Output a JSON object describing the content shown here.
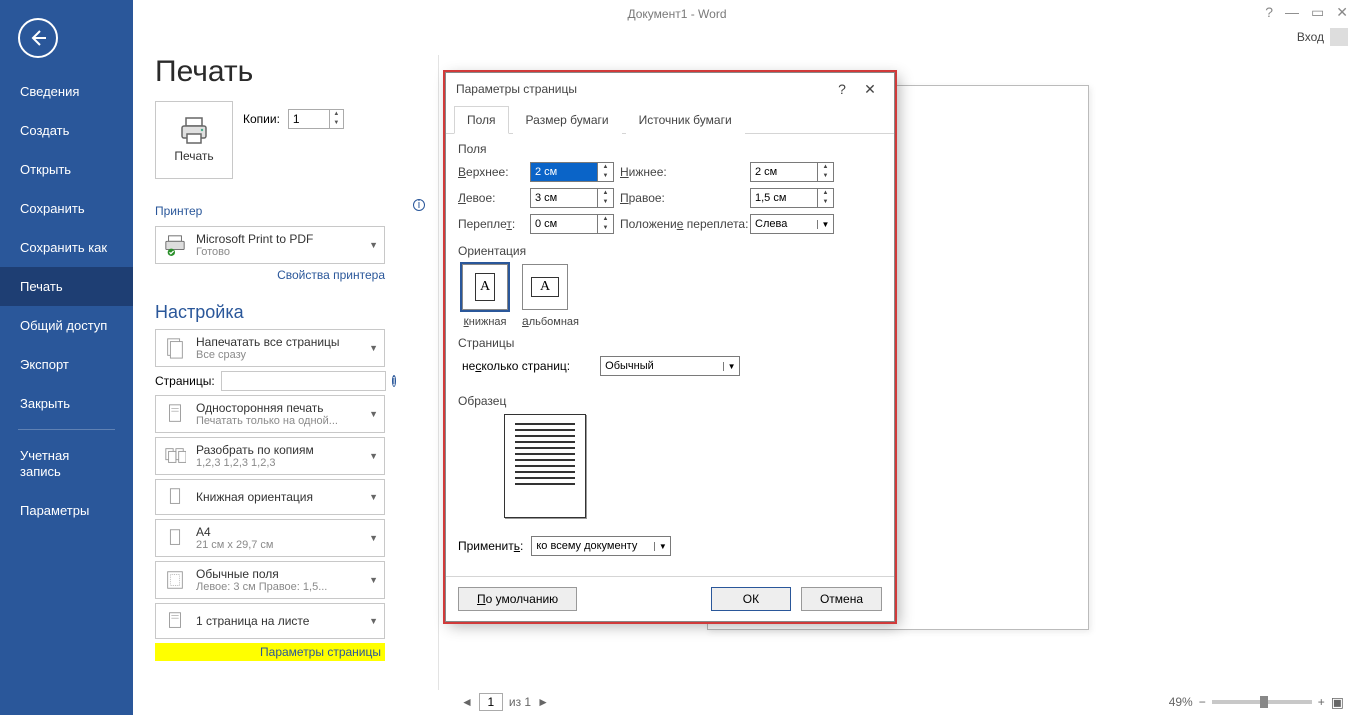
{
  "titlebar": {
    "title": "Документ1 - Word",
    "signin": "Вход"
  },
  "sidebar": {
    "items": [
      "Сведения",
      "Создать",
      "Открыть",
      "Сохранить",
      "Сохранить как",
      "Печать",
      "Общий доступ",
      "Экспорт",
      "Закрыть"
    ],
    "bottom": [
      "Учетная запись",
      "Параметры"
    ],
    "selected": 5
  },
  "print": {
    "title": "Печать",
    "button": "Печать",
    "copies_label": "Копии:",
    "copies_value": "1",
    "printer_head": "Принтер",
    "printer_name": "Microsoft Print to PDF",
    "printer_status": "Готово",
    "printer_props": "Свойства принтера",
    "settings_head": "Настройка",
    "settings": [
      {
        "t1": "Напечатать все страницы",
        "t2": "Все сразу"
      },
      {
        "t1": "Односторонняя печать",
        "t2": "Печатать только на одной..."
      },
      {
        "t1": "Разобрать по копиям",
        "t2": "1,2,3   1,2,3   1,2,3"
      },
      {
        "t1": "Книжная ориентация",
        "t2": ""
      },
      {
        "t1": "A4",
        "t2": "21 см x 29,7 см"
      },
      {
        "t1": "Обычные поля",
        "t2": "Левое:  3 см   Правое:  1,5..."
      },
      {
        "t1": "1 страница на листе",
        "t2": ""
      }
    ],
    "pages_label": "Страницы:",
    "page_params": "Параметры страницы"
  },
  "footer": {
    "page_value": "1",
    "of_label": "из 1",
    "zoom": "49%"
  },
  "dialog": {
    "title": "Параметры страницы",
    "tabs": [
      "Поля",
      "Размер бумаги",
      "Источник бумаги"
    ],
    "group_fields": "Поля",
    "top_label": "Верхнее:",
    "top_val": "2 см",
    "bottom_label": "Нижнее:",
    "bottom_val": "2 см",
    "left_label": "Левое:",
    "left_val": "3 см",
    "right_label": "Правое:",
    "right_val": "1,5 см",
    "gutter_label": "Переплет:",
    "gutter_val": "0 см",
    "gutter_pos_label": "Положение переплета:",
    "gutter_pos_val": "Слева",
    "group_orient": "Ориентация",
    "orient_portrait": "книжная",
    "orient_landscape": "альбомная",
    "group_pages": "Страницы",
    "multi_label": "несколько страниц:",
    "multi_val": "Обычный",
    "group_sample": "Образец",
    "apply_label": "Применить:",
    "apply_val": "ко всему документу",
    "default_btn": "По умолчанию",
    "ok": "ОК",
    "cancel": "Отмена"
  }
}
